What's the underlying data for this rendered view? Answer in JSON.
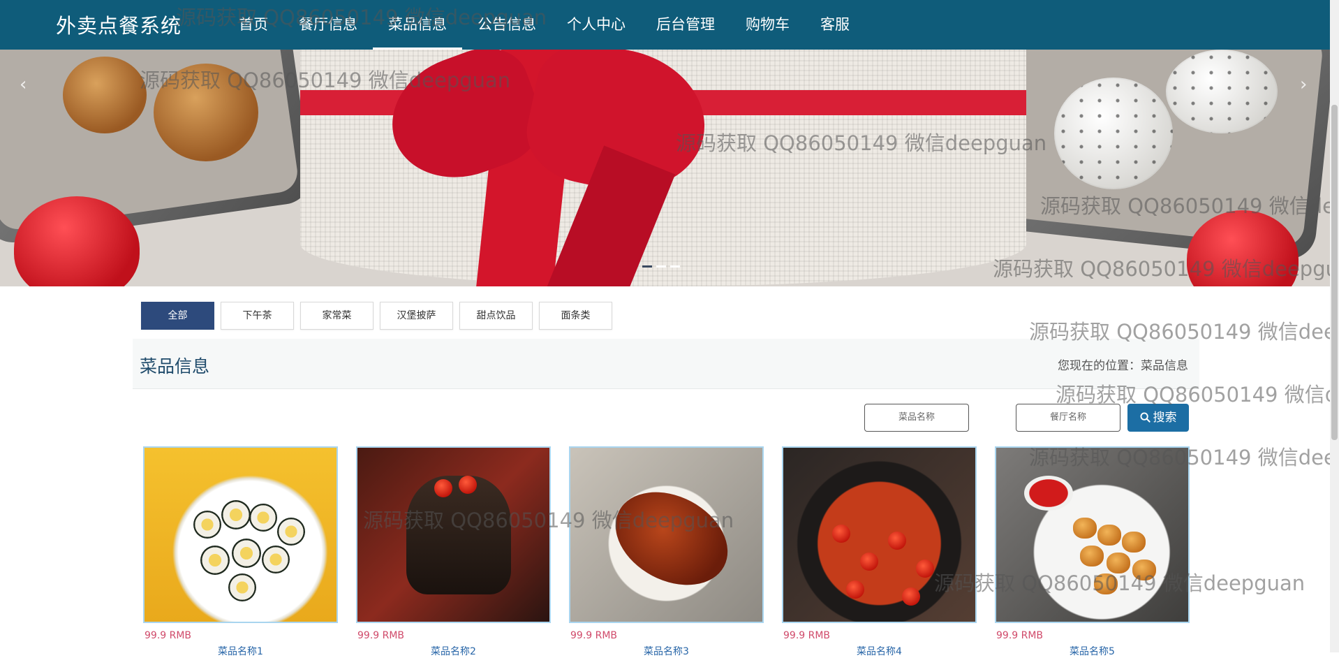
{
  "nav": {
    "brand": "外卖点餐系统",
    "items": [
      {
        "label": "首页"
      },
      {
        "label": "餐厅信息"
      },
      {
        "label": "菜品信息",
        "active": true
      },
      {
        "label": "公告信息"
      },
      {
        "label": "个人中心"
      },
      {
        "label": "后台管理"
      },
      {
        "label": "购物车"
      },
      {
        "label": "客服"
      }
    ]
  },
  "banner": {
    "prev_icon": "chevron-left-icon",
    "next_icon": "chevron-right-icon",
    "slide_count": 3,
    "active_slide": 1
  },
  "categories": [
    {
      "label": "全部",
      "active": true
    },
    {
      "label": "下午茶"
    },
    {
      "label": "家常菜"
    },
    {
      "label": "汉堡披萨"
    },
    {
      "label": "甜点饮品"
    },
    {
      "label": "面条类"
    }
  ],
  "section": {
    "title": "菜品信息",
    "breadcrumb": "您现在的位置：菜品信息"
  },
  "search": {
    "dish_placeholder": "菜品名称",
    "restaurant_placeholder": "餐厅名称",
    "button_label": "搜索",
    "button_icon": "search-icon"
  },
  "products": [
    {
      "price": "99.9 RMB",
      "name": "菜品名称1"
    },
    {
      "price": "99.9 RMB",
      "name": "菜品名称2"
    },
    {
      "price": "99.9 RMB",
      "name": "菜品名称3"
    },
    {
      "price": "99.9 RMB",
      "name": "菜品名称4"
    },
    {
      "price": "99.9 RMB",
      "name": "菜品名称5"
    }
  ],
  "watermark": "源码获取 QQ86050149 微信deepguan",
  "colors": {
    "nav_bg": "#0f5c7a",
    "active_tab": "#2d4a7c",
    "search_button": "#1c6ea4",
    "price": "#d04a6a",
    "product_name": "#2866a8"
  }
}
